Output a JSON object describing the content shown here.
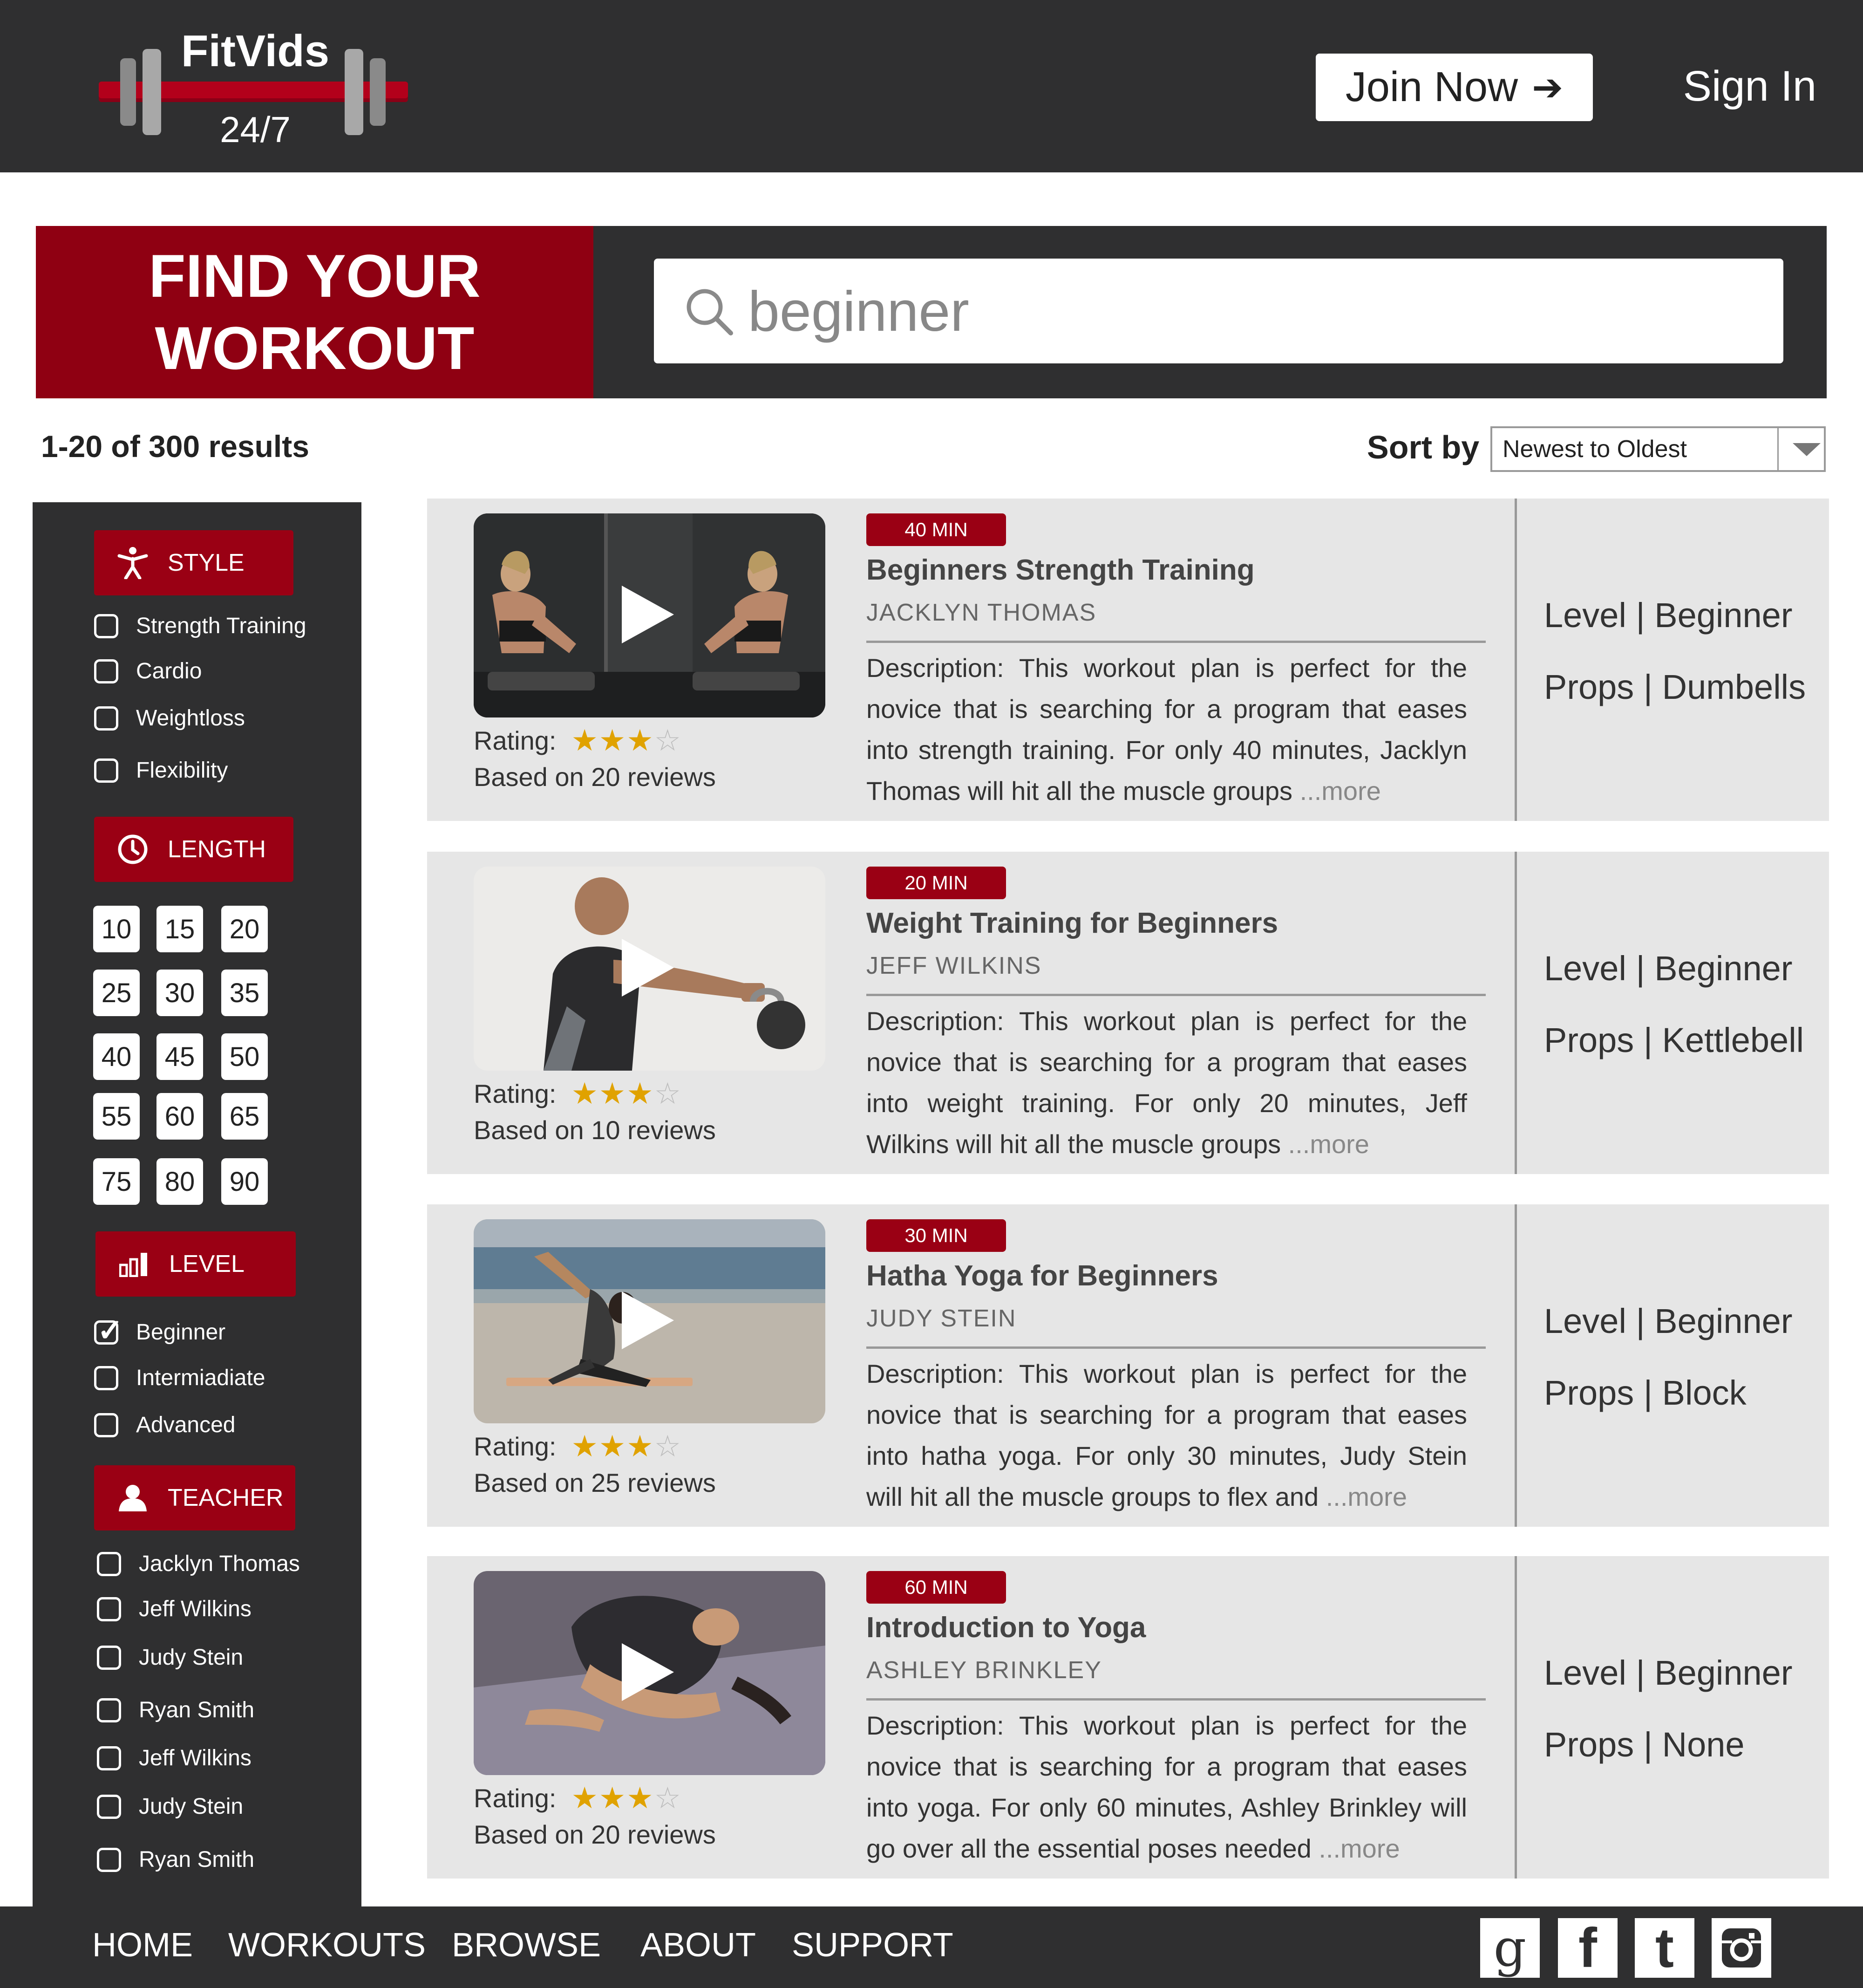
{
  "header": {
    "logo_brand": "FitVids",
    "logo_sub": "24/7",
    "join_label": "Join Now",
    "join_arrow": "➔",
    "signin_label": "Sign In"
  },
  "hero": {
    "title": "FIND YOUR WORKOUT",
    "search_value": "beginner"
  },
  "results": {
    "count": "1-20 of 300 results",
    "sort_label": "Sort by",
    "sort_value": "Newest to Oldest"
  },
  "sidebar": {
    "style": {
      "label": "STYLE",
      "icon": "person-stretch-icon",
      "items": [
        "Strength Training",
        "Cardio",
        "Weightloss",
        "Flexibility"
      ]
    },
    "length": {
      "label": "LENGTH",
      "icon": "clock-icon",
      "items": [
        "10",
        "15",
        "20",
        "25",
        "30",
        "35",
        "40",
        "45",
        "50",
        "55",
        "60",
        "65",
        "75",
        "80",
        "90"
      ]
    },
    "level": {
      "label": "LEVEL",
      "icon": "bar-chart-icon",
      "items": [
        "Beginner",
        "Intermiadiate",
        "Advanced"
      ],
      "checked": "Beginner"
    },
    "teacher": {
      "label": "TEACHER",
      "icon": "user-icon",
      "items": [
        "Jacklyn Thomas",
        "Jeff Wilkins",
        "Judy Stein",
        "Ryan Smith",
        "Jeff Wilkins",
        "Judy Stein",
        "Ryan Smith"
      ]
    }
  },
  "cards": [
    {
      "badge": "40 MIN",
      "title": "Beginners Strength Training",
      "teacher": "JACKLYN THOMAS",
      "description": "Description: This workout plan is perfect for the novice that is searching for a program that eases into strength training. For only 40 minutes, Jacklyn Thomas will hit all the muscle groups",
      "more": "...more",
      "rating_label": "Rating:",
      "stars": 3,
      "reviews": "Based on 20 reviews",
      "level": "Level | Beginner",
      "props": "Props | Dumbells"
    },
    {
      "badge": "20 MIN",
      "title": "Weight Training for Beginners",
      "teacher": "JEFF WILKINS",
      "description": "Description: This workout plan is perfect for the novice that is searching for a program that eases into weight training. For only 20 minutes, Jeff Wilkins will hit all the muscle groups",
      "more": "...more",
      "rating_label": "Rating:",
      "stars": 3,
      "reviews": "Based on 10 reviews",
      "level": "Level | Beginner",
      "props": "Props | Kettlebell"
    },
    {
      "badge": "30 MIN",
      "title": "Hatha Yoga for Beginners",
      "teacher": "JUDY STEIN",
      "description": "Description: This workout plan is perfect for the novice that is searching for a program that eases into hatha yoga. For only 30 minutes, Judy Stein will hit all the muscle groups to flex and",
      "more": "...more",
      "rating_label": "Rating:",
      "stars": 3,
      "reviews": "Based on 25 reviews",
      "level": "Level | Beginner",
      "props": "Props | Block"
    },
    {
      "badge": "60 MIN",
      "title": "Introduction to Yoga",
      "teacher": "ASHLEY BRINKLEY",
      "description": "Description: This workout plan is perfect for the novice that is searching for a program that eases into yoga. For only 60 minutes, Ashley Brinkley will go over all the essential poses needed",
      "more": "...more",
      "rating_label": "Rating:",
      "stars": 3,
      "reviews": "Based on 20 reviews",
      "level": "Level | Beginner",
      "props": "Props | None"
    }
  ],
  "footer": {
    "nav": [
      "HOME",
      "WORKOUTS",
      "BROWSE",
      "ABOUT",
      "SUPPORT"
    ],
    "social": [
      {
        "icon": "google-icon",
        "glyph": "g"
      },
      {
        "icon": "facebook-icon",
        "glyph": "f"
      },
      {
        "icon": "tumblr-icon",
        "glyph": "t"
      },
      {
        "icon": "instagram-icon",
        "glyph": ""
      }
    ]
  },
  "colors": {
    "dark": "#2f2f30",
    "brand_red": "#9a0014",
    "hero_red": "#8f0012",
    "card_bg": "#e6e6e6",
    "star": "#e0a200"
  }
}
